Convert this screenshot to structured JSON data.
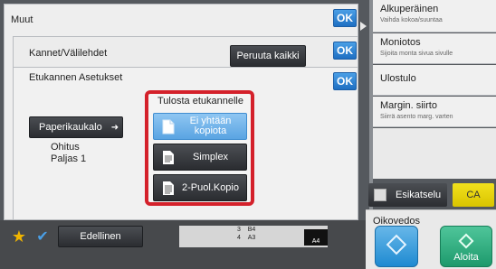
{
  "top_panel": {
    "title": "Muut",
    "ok_label": "OK"
  },
  "second_panel": {
    "title": "Kannet/Välilehdet",
    "cancel_all_label": "Peruuta kaikki",
    "ok_label": "OK"
  },
  "third_panel": {
    "title": "Etukannen Asetukset",
    "ok_label": "OK",
    "paper_tray_label": "Paperikaukalo",
    "paper_info_line1": "Ohitus",
    "paper_info_line2": "Paljas 1",
    "print_group": {
      "title": "Tulosta etukannelle",
      "options": [
        {
          "label_line1": "Ei yhtään",
          "label_line2": "kopiota",
          "selected": true
        },
        {
          "label_line1": "Simplex",
          "label_line2": "",
          "selected": false
        },
        {
          "label_line1": "2-Puol.Kopio",
          "label_line2": "",
          "selected": false
        }
      ]
    }
  },
  "right_menu": [
    {
      "title": "Alkuperäinen",
      "subtitle": "Vaihda kokoa/suuntaa"
    },
    {
      "title": "Moniotos",
      "subtitle": "Sijoita monta sivua sivulle"
    },
    {
      "title": "Ulostulo",
      "subtitle": ""
    },
    {
      "title": "Margin. siirto",
      "subtitle": "Siirrä asento marg. varten"
    }
  ],
  "actions": {
    "preview_label": "Esikatselu",
    "ca_label": "CA",
    "proof_label": "Oikovedos",
    "start_label": "Aloita"
  },
  "bottom_bar": {
    "previous_label": "Edellinen",
    "tray_rows": [
      {
        "tray": "3",
        "size": "B4"
      },
      {
        "tray": "4",
        "size": "A3"
      }
    ],
    "paper_size": "A4"
  },
  "colors": {
    "ok_blue": "#1e6fc2",
    "highlight_red": "#d4212b",
    "ca_yellow": "#e6d20c",
    "start_green": "#1d9a6c",
    "selected_option": "#5aa4e2"
  }
}
